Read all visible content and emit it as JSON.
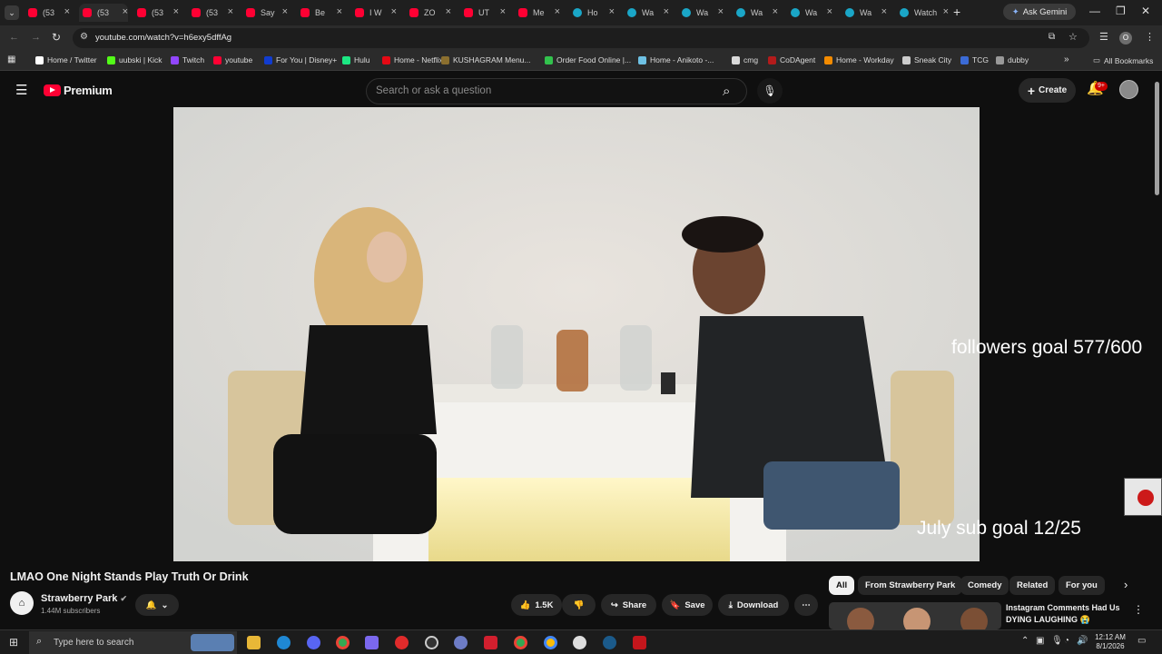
{
  "tabs": [
    {
      "label": "(53",
      "icon": "youtube-icon"
    },
    {
      "label": "(53",
      "icon": "youtube-icon",
      "active": true
    },
    {
      "label": "(53",
      "icon": "youtube-icon"
    },
    {
      "label": "(53",
      "icon": "youtube-icon"
    },
    {
      "label": "Say",
      "icon": "youtube-icon"
    },
    {
      "label": "Be",
      "icon": "youtube-icon"
    },
    {
      "label": "I W",
      "icon": "youtube-icon"
    },
    {
      "label": "ZO",
      "icon": "youtube-icon"
    },
    {
      "label": "UT",
      "icon": "youtube-icon"
    },
    {
      "label": "Me",
      "icon": "youtube-icon"
    },
    {
      "label": "Ho",
      "icon": "globe-icon"
    },
    {
      "label": "Wa",
      "icon": "globe-icon"
    },
    {
      "label": "Wa",
      "icon": "globe-icon"
    },
    {
      "label": "Wa",
      "icon": "globe-icon"
    },
    {
      "label": "Wa",
      "icon": "globe-icon"
    },
    {
      "label": "Wa",
      "icon": "globe-icon"
    },
    {
      "label": "Watch",
      "icon": "globe-icon"
    }
  ],
  "ask_gemini": "Ask Gemini",
  "url": "youtube.com/watch?v=h6exy5dffAg",
  "profile_initial": "O",
  "bookmarks": [
    {
      "label": "Home / Twitter",
      "color": "#ffffff"
    },
    {
      "label": "uubski | Kick",
      "color": "#53fc18"
    },
    {
      "label": "Twitch",
      "color": "#9146ff"
    },
    {
      "label": "youtube",
      "color": "#ff0033"
    },
    {
      "label": "For You | Disney+",
      "color": "#113ccf"
    },
    {
      "label": "Hulu",
      "color": "#1ce783"
    },
    {
      "label": "Home - Netflix",
      "color": "#e50914"
    },
    {
      "label": "KUSHAGRAM Menu...",
      "color": "#8b6f2f"
    },
    {
      "label": "Order Food Online |...",
      "color": "#32c24d"
    },
    {
      "label": "Home - Anikoto -...",
      "color": "#6ec1e4"
    },
    {
      "label": "cmg",
      "color": "#d9d9d9"
    },
    {
      "label": "CoDAgent",
      "color": "#b31b1b"
    },
    {
      "label": "Home - Workday",
      "color": "#f38b00"
    },
    {
      "label": "Sneak City",
      "color": "#cccccc"
    },
    {
      "label": "TCG",
      "color": "#3b6bd6"
    },
    {
      "label": "dubby",
      "color": "#999999"
    }
  ],
  "all_bookmarks": "All Bookmarks",
  "youtube": {
    "logo_text": "Premium",
    "search_placeholder": "Search or ask a question",
    "create_label": "Create",
    "notif_badge": "9+"
  },
  "overlay": {
    "followers": "followers goal 577/600",
    "subs": "July sub goal 12/25"
  },
  "video": {
    "title": "LMAO One Night Stands Play Truth Or Drink",
    "channel": "Strawberry Park",
    "subscribers": "1.44M subscribers",
    "likes": "1.5K",
    "share": "Share",
    "save": "Save",
    "download": "Download"
  },
  "chips": [
    "All",
    "From Strawberry Park",
    "Comedy",
    "Related",
    "For you"
  ],
  "recommendation": {
    "title_line1": "Instagram Comments Had Us",
    "title_line2": "DYING LAUGHING 😭"
  },
  "taskbar": {
    "search_text": "Type here to search",
    "time": "12:12 AM",
    "date": "8/1/2026"
  }
}
